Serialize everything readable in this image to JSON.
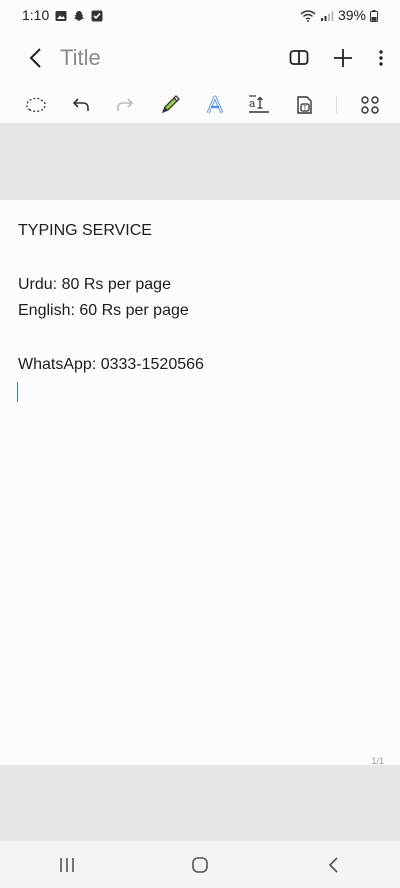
{
  "status_bar": {
    "time": "1:10",
    "battery": "39%"
  },
  "header": {
    "title": "Title"
  },
  "note": {
    "lines": [
      "TYPING SERVICE",
      "Urdu: 80 Rs per page",
      "English: 60 Rs per page",
      "WhatsApp: 0333-1520566"
    ]
  },
  "page_indicator": "1/1",
  "icons": {
    "status_left": [
      "gallery-icon",
      "snapchat-icon",
      "checkbox-icon"
    ],
    "status_right": [
      "wifi-icon",
      "signal-icon",
      "battery-icon"
    ],
    "header": [
      "back-icon",
      "book-view-icon",
      "add-icon",
      "more-options-icon"
    ],
    "toolbar": [
      "lasso-icon",
      "undo-icon",
      "redo-icon",
      "pen-icon",
      "text-style-icon",
      "text-size-icon",
      "text-box-icon",
      "more-tools-icon"
    ],
    "nav": [
      "recent-apps-icon",
      "home-icon",
      "nav-back-icon"
    ]
  }
}
